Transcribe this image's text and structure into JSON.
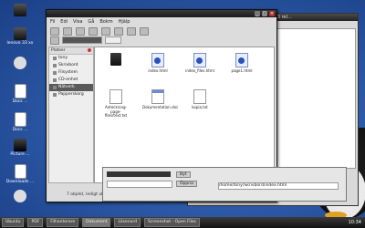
{
  "desktop": {
    "icons": [
      {
        "label": "",
        "icon": "computer-icon"
      },
      {
        "label": "lenovo 33 xx",
        "icon": "drive-icon"
      },
      {
        "label": "",
        "icon": "trash-icon"
      },
      {
        "label": "Docs ...",
        "icon": "document-icon"
      },
      {
        "label": "Docs ...",
        "icon": "document-icon"
      },
      {
        "label": "Picture ...",
        "icon": "video-icon"
      },
      {
        "label": "Downloads ...",
        "icon": "document-icon"
      },
      {
        "label": "",
        "icon": "network-icon"
      }
    ]
  },
  "background_window": {
    "title": "Iter Pilot Kinosek @m Hola 3 rel... "
  },
  "file_manager": {
    "title": "",
    "menu": [
      "Fil",
      "Edi",
      "Visa",
      "Gå",
      "Bokm",
      "Hjälp"
    ],
    "location": {
      "crumb1": "",
      "crumb2": ""
    },
    "sidebar": {
      "header": "Platser",
      "items": [
        {
          "label": "tony",
          "selected": false
        },
        {
          "label": "Skrivbord",
          "selected": false
        },
        {
          "label": "Filsystem",
          "selected": false
        },
        {
          "label": "CD-enhet",
          "selected": false
        },
        {
          "label": "Nätverk",
          "selected": true
        },
        {
          "label": "Papperskorg",
          "selected": false
        }
      ]
    },
    "files": [
      {
        "name": "",
        "type": "folder"
      },
      {
        "name": "index.html",
        "type": "html"
      },
      {
        "name": "index_files.html",
        "type": "html"
      },
      {
        "name": "page1.html",
        "type": "html"
      },
      {
        "name": "Anteckning-page-files/text.txt",
        "type": "txt"
      },
      {
        "name": "Dokumentation.doc",
        "type": "doc"
      },
      {
        "name": "kopia.txt",
        "type": "txt"
      }
    ],
    "status": "7 objekt, ledigt utrymme: 1,5 GB"
  },
  "dialog": {
    "field1": "",
    "field2": "",
    "buttons": [
      "Byt",
      "Öppna"
    ],
    "path": "/home/tony/Skrivbord/index.html"
  },
  "taskbar": {
    "items": [
      "Ubuntu",
      "PDF",
      "Filhanterare",
      "Dokument",
      "Lösenord",
      "Screenshot - Open Files"
    ],
    "clock": "10:34"
  }
}
